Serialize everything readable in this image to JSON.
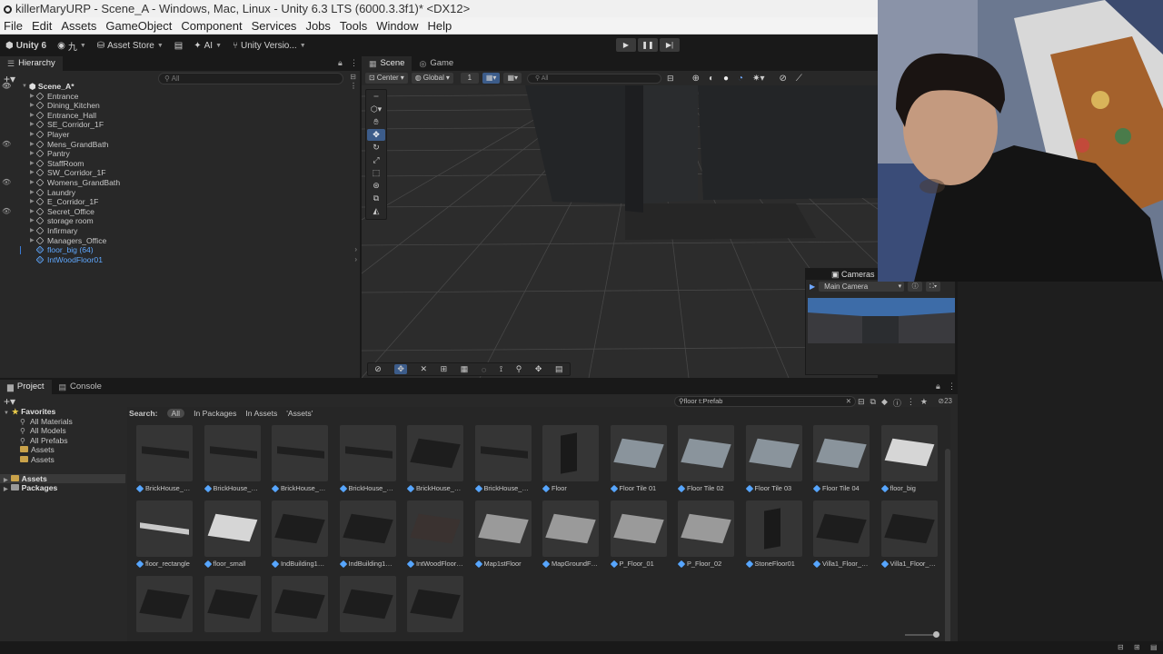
{
  "window": {
    "title": "killerMaryURP - Scene_A - Windows, Mac, Linux - Unity 6.3 LTS (6000.3.3f1)* <DX12>"
  },
  "menu": [
    "File",
    "Edit",
    "Assets",
    "GameObject",
    "Component",
    "Services",
    "Jobs",
    "Tools",
    "Window",
    "Help"
  ],
  "toolbar": {
    "unity_label": "Unity 6",
    "account_label": "九",
    "asset_store": "Asset Store",
    "ai": "AI",
    "version": "Unity Versio..."
  },
  "hierarchy": {
    "tab": "Hierarchy",
    "search_placeholder": "All",
    "scene": "Scene_A*",
    "items": [
      {
        "label": "Entrance",
        "eye": false
      },
      {
        "label": "Dining_Kitchen",
        "eye": false
      },
      {
        "label": "Entrance_Hall",
        "eye": false
      },
      {
        "label": "SE_Corridor_1F",
        "eye": false
      },
      {
        "label": "Player",
        "eye": false
      },
      {
        "label": "Mens_GrandBath",
        "eye": true
      },
      {
        "label": "Pantry",
        "eye": false
      },
      {
        "label": "StaffRoom",
        "eye": false
      },
      {
        "label": "SW_Corridor_1F",
        "eye": false
      },
      {
        "label": "Womens_GrandBath",
        "eye": true
      },
      {
        "label": "Laundry",
        "eye": false
      },
      {
        "label": "E_Corridor_1F",
        "eye": false
      },
      {
        "label": "Secret_Office",
        "eye": true
      },
      {
        "label": "storage room",
        "eye": false
      },
      {
        "label": "Infirmary",
        "eye": false
      },
      {
        "label": "Managers_Office",
        "eye": false
      }
    ],
    "prefabs": [
      "floor_big (64)",
      "IntWoodFloor01"
    ]
  },
  "scene_view": {
    "tabs": [
      "Scene",
      "Game"
    ],
    "pivot": "Center",
    "space": "Global",
    "grid_value": "1",
    "search_placeholder": "All"
  },
  "cameras_overlay": {
    "title": "Cameras",
    "selected_camera": "Main Camera"
  },
  "project": {
    "tabs": [
      "Project",
      "Console"
    ],
    "search_value": "floor t:Prefab",
    "count": "23",
    "favorites_header": "Favorites",
    "favorites": [
      "All Materials",
      "All Models",
      "All Prefabs",
      "Assets",
      "Assets"
    ],
    "roots": [
      "Assets",
      "Packages"
    ],
    "search_label": "Search:",
    "search_scopes": [
      "All",
      "In Packages",
      "In Assets",
      "'Assets'"
    ],
    "assets": [
      "BrickHouse_Flo...",
      "BrickHouse_Flo...",
      "BrickHouse_Flo...",
      "BrickHouse_Flo...",
      "BrickHouse_Flo...",
      "BrickHouse_Flo...",
      "Floor",
      "Floor Tile 01",
      "Floor Tile 02",
      "Floor Tile 03",
      "Floor Tile 04",
      "floor_big",
      "floor_rectangle",
      "floor_small",
      "IndBuilding1_Fl...",
      "IndBuilding1_Fl...",
      "IntWoodFloor01",
      "Map1stFloor",
      "MapGroundFloor",
      "P_Floor_01",
      "P_Floor_02",
      "StoneFloor01",
      "Villa1_Floor_Mi...",
      "Villa1_Floor_Mi...",
      "",
      "",
      "",
      "",
      ""
    ]
  }
}
